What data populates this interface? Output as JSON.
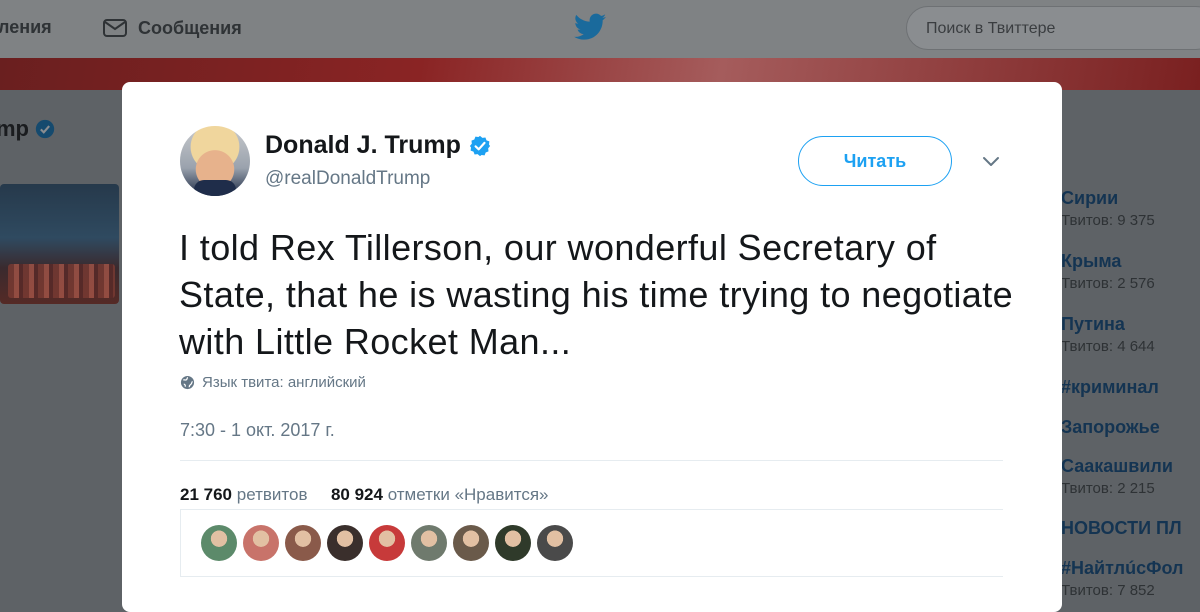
{
  "nav": {
    "notifications_partial": "ления",
    "messages_label": "Сообщения",
    "search_placeholder": "Поиск в Твиттере"
  },
  "background_profile": {
    "name_partial": "mp"
  },
  "trends": [
    {
      "name": "Сирии",
      "count": "Твитов: 9 375"
    },
    {
      "name": "Крыма",
      "count": "Твитов: 2 576"
    },
    {
      "name": "Путина",
      "count": "Твитов: 4 644"
    },
    {
      "name": "#криминал",
      "count": ""
    },
    {
      "name": "Запорожье",
      "count": ""
    },
    {
      "name": "Саакашвили",
      "count": "Твитов: 2 215"
    },
    {
      "name": "НОВОСТИ ПЛ",
      "count": ""
    },
    {
      "name": "#НайтлúсФол",
      "count": "Твитов: 7 852"
    }
  ],
  "tweet": {
    "display_name": "Donald J. Trump",
    "handle": "@realDonaldTrump",
    "follow_label": "Читать",
    "text": "I told Rex Tillerson, our wonderful Secretary of State, that he is wasting his time trying to negotiate with Little Rocket Man...",
    "language": "Язык твита: английский",
    "timestamp": "7:30 - 1 окт. 2017 г.",
    "retweets_count": "21 760",
    "retweets_label": "ретвитов",
    "likes_count": "80 924",
    "likes_label": "отметки «Нравится»"
  },
  "colors": {
    "accent": "#1da1f2",
    "text": "#14171a",
    "secondary_text": "#657786",
    "overlay": "#5e6266"
  },
  "icons": [
    "envelope-icon",
    "twitter-bird-icon",
    "verified-badge-icon",
    "chevron-down-icon",
    "globe-icon"
  ],
  "likers": [
    {
      "color": "#5c8a6a"
    },
    {
      "color": "#c8736a"
    },
    {
      "color": "#8a5a4a"
    },
    {
      "color": "#3a2f2c"
    },
    {
      "color": "#c73a3a"
    },
    {
      "color": "#6f7a6d"
    },
    {
      "color": "#6a5a4a"
    },
    {
      "color": "#2f3a2a"
    },
    {
      "color": "#4a4a4a"
    }
  ]
}
